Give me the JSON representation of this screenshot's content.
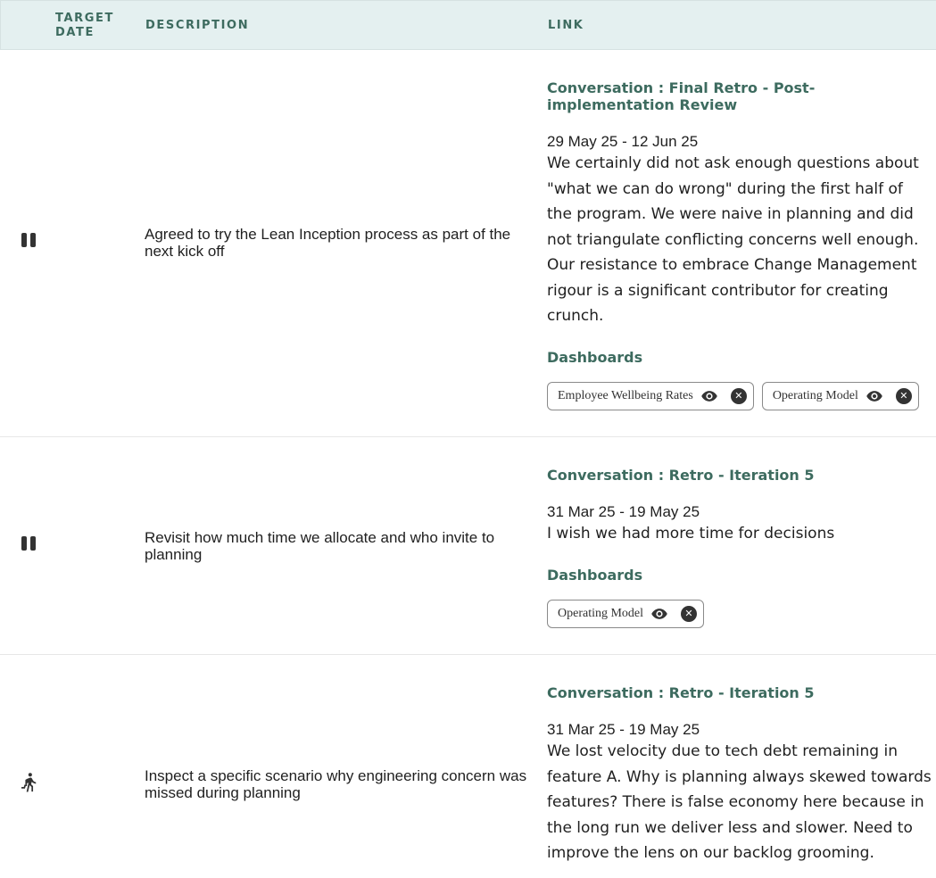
{
  "columns": {
    "target_date": "TARGET DATE",
    "description": "DESCRIPTION",
    "link": "LINK"
  },
  "rows": [
    {
      "status_icon": "pause-icon",
      "description": "Agreed to try the Lean Inception process as part of the next kick off",
      "conversation_title": "Conversation : Final Retro - Post-implementation Review",
      "date_range": "29 May 25 - 12 Jun 25",
      "text": "We certainly did not ask enough questions about \"what we can do wrong\" during the first half of the program. We were naive in planning and did not triangulate conflicting concerns well enough. Our resistance to embrace Change Management rigour is a significant contributor for creating crunch.",
      "dashboards_label": "Dashboards",
      "dashboards": [
        "Employee Wellbeing Rates",
        "Operating Model"
      ]
    },
    {
      "status_icon": "pause-icon",
      "description": "Revisit how much time we allocate and who invite to planning",
      "conversation_title": "Conversation : Retro - Iteration 5",
      "date_range": "31 Mar 25 - 19 May 25",
      "text": "I wish we had more time for decisions",
      "dashboards_label": "Dashboards",
      "dashboards": [
        "Operating Model"
      ]
    },
    {
      "status_icon": "running-icon",
      "description": "Inspect a specific scenario why engineering concern was missed during planning",
      "conversation_title": "Conversation : Retro - Iteration 5",
      "date_range": "31 Mar 25 - 19 May 25",
      "text": "We lost velocity due to tech debt remaining in feature A. Why is planning always skewed towards features? There is false economy here because in the long run we deliver less and slower. Need to improve the lens on our backlog grooming."
    }
  ]
}
